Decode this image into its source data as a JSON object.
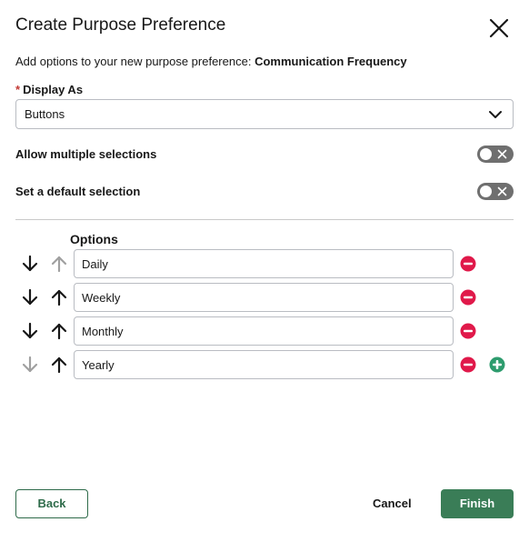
{
  "dialog": {
    "title": "Create Purpose Preference",
    "close_icon": "close-icon",
    "subtitle_prefix": "Add options to your new purpose preference: ",
    "subtitle_name": "Communication Frequency"
  },
  "display_as": {
    "required_mark": "*",
    "label": "Display As",
    "value": "Buttons",
    "icon": "chevron-down-icon"
  },
  "toggles": {
    "allow_multiple": {
      "label": "Allow multiple selections",
      "checked": false
    },
    "default_selection": {
      "label": "Set a default selection",
      "checked": false
    }
  },
  "options": {
    "header": "Options",
    "items": [
      {
        "value": "Daily",
        "down_enabled": true,
        "up_enabled": false
      },
      {
        "value": "Weekly",
        "down_enabled": true,
        "up_enabled": true
      },
      {
        "value": "Monthly",
        "down_enabled": true,
        "up_enabled": true
      },
      {
        "value": "Yearly",
        "down_enabled": false,
        "up_enabled": true
      }
    ],
    "remove_icon": "minus-circle-icon",
    "add_icon": "plus-circle-icon"
  },
  "footer": {
    "back_label": "Back",
    "cancel_label": "Cancel",
    "finish_label": "Finish"
  },
  "colors": {
    "brand_green": "#3a7d57",
    "remove_red": "#e0194a",
    "add_green": "#2e9c6e",
    "toggle_off": "#6f6f6f"
  }
}
